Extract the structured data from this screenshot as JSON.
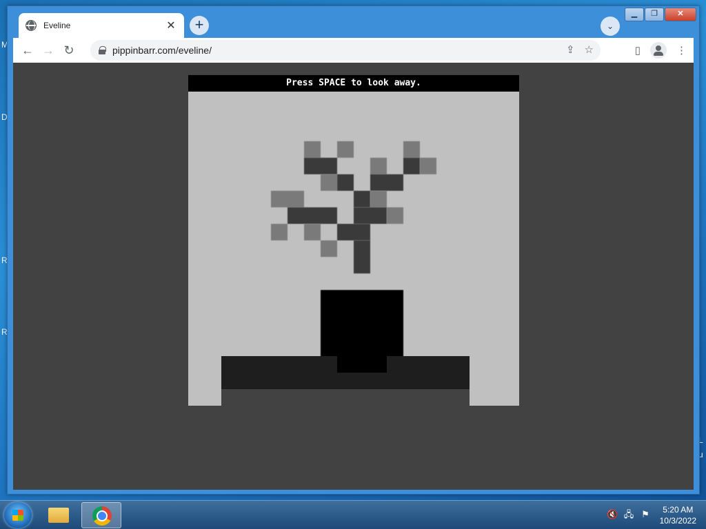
{
  "desktop": {
    "edge_letters": [
      "M",
      "D",
      "R",
      "R",
      "L",
      "u"
    ]
  },
  "browser": {
    "tab": {
      "title": "Eveline",
      "close_glyph": "✕",
      "icon": "globe-icon"
    },
    "new_tab_glyph": "+",
    "tab_search_glyph": "⌄",
    "window_controls": {
      "minimize": "▁",
      "maximize": "❐",
      "close": "✕"
    },
    "nav": {
      "back": "←",
      "forward": "→",
      "reload": "↻"
    },
    "address": {
      "url": "pippinbarr.com/eveline/"
    },
    "omnibox_icons": {
      "share": "⇪",
      "bookmark": "☆"
    },
    "right_icons": {
      "side_panel": "▯",
      "menu": "⋮"
    }
  },
  "game": {
    "message": "Press SPACE to look away.",
    "colors": {
      "background": "#c0c0c0",
      "branch_light": "#7a7a7a",
      "branch_dark": "#3a3a3a",
      "pot": "#000000",
      "table": "#1e1e1e",
      "page": "#424242"
    }
  },
  "taskbar": {
    "apps": [
      "start-button",
      "file-explorer",
      "google-chrome"
    ],
    "tray_icons": [
      "speaker-muted-icon",
      "network-icon",
      "action-center-icon"
    ],
    "clock": {
      "time": "5:20 AM",
      "date": "10/3/2022"
    }
  }
}
